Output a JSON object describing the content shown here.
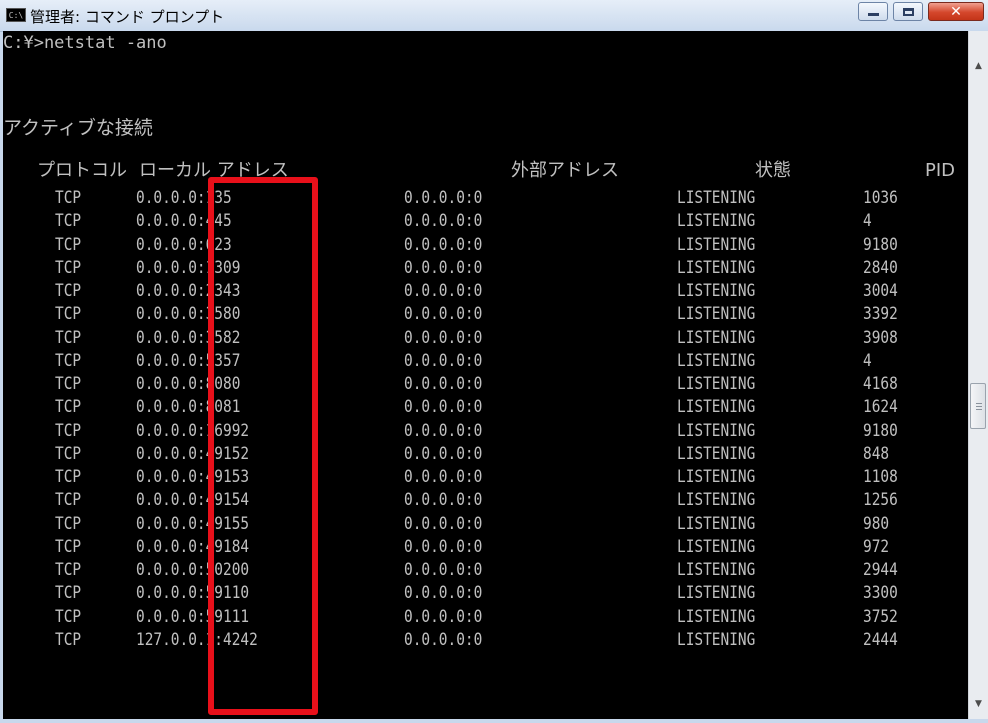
{
  "window": {
    "title": "管理者: コマンド プロンプト",
    "icon_label": "C:\\"
  },
  "console": {
    "command_line": "C:¥>netstat -ano",
    "heading": "アクティブな接続",
    "columns": {
      "proto": "プロトコル",
      "local": "ローカル アドレス",
      "foreign": "外部アドレス",
      "state": "状態",
      "pid": "PID"
    },
    "rows": [
      {
        "proto": "TCP",
        "local": "0.0.0.0:135",
        "foreign": "0.0.0.0:0",
        "state": "LISTENING",
        "pid": "1036"
      },
      {
        "proto": "TCP",
        "local": "0.0.0.0:445",
        "foreign": "0.0.0.0:0",
        "state": "LISTENING",
        "pid": "4"
      },
      {
        "proto": "TCP",
        "local": "0.0.0.0:623",
        "foreign": "0.0.0.0:0",
        "state": "LISTENING",
        "pid": "9180"
      },
      {
        "proto": "TCP",
        "local": "0.0.0.0:1309",
        "foreign": "0.0.0.0:0",
        "state": "LISTENING",
        "pid": "2840"
      },
      {
        "proto": "TCP",
        "local": "0.0.0.0:2343",
        "foreign": "0.0.0.0:0",
        "state": "LISTENING",
        "pid": "3004"
      },
      {
        "proto": "TCP",
        "local": "0.0.0.0:3580",
        "foreign": "0.0.0.0:0",
        "state": "LISTENING",
        "pid": "3392"
      },
      {
        "proto": "TCP",
        "local": "0.0.0.0:3582",
        "foreign": "0.0.0.0:0",
        "state": "LISTENING",
        "pid": "3908"
      },
      {
        "proto": "TCP",
        "local": "0.0.0.0:5357",
        "foreign": "0.0.0.0:0",
        "state": "LISTENING",
        "pid": "4"
      },
      {
        "proto": "TCP",
        "local": "0.0.0.0:8080",
        "foreign": "0.0.0.0:0",
        "state": "LISTENING",
        "pid": "4168"
      },
      {
        "proto": "TCP",
        "local": "0.0.0.0:8081",
        "foreign": "0.0.0.0:0",
        "state": "LISTENING",
        "pid": "1624"
      },
      {
        "proto": "TCP",
        "local": "0.0.0.0:16992",
        "foreign": "0.0.0.0:0",
        "state": "LISTENING",
        "pid": "9180"
      },
      {
        "proto": "TCP",
        "local": "0.0.0.0:49152",
        "foreign": "0.0.0.0:0",
        "state": "LISTENING",
        "pid": "848"
      },
      {
        "proto": "TCP",
        "local": "0.0.0.0:49153",
        "foreign": "0.0.0.0:0",
        "state": "LISTENING",
        "pid": "1108"
      },
      {
        "proto": "TCP",
        "local": "0.0.0.0:49154",
        "foreign": "0.0.0.0:0",
        "state": "LISTENING",
        "pid": "1256"
      },
      {
        "proto": "TCP",
        "local": "0.0.0.0:49155",
        "foreign": "0.0.0.0:0",
        "state": "LISTENING",
        "pid": "980"
      },
      {
        "proto": "TCP",
        "local": "0.0.0.0:49184",
        "foreign": "0.0.0.0:0",
        "state": "LISTENING",
        "pid": "972"
      },
      {
        "proto": "TCP",
        "local": "0.0.0.0:50200",
        "foreign": "0.0.0.0:0",
        "state": "LISTENING",
        "pid": "2944"
      },
      {
        "proto": "TCP",
        "local": "0.0.0.0:59110",
        "foreign": "0.0.0.0:0",
        "state": "LISTENING",
        "pid": "3300"
      },
      {
        "proto": "TCP",
        "local": "0.0.0.0:59111",
        "foreign": "0.0.0.0:0",
        "state": "LISTENING",
        "pid": "3752"
      },
      {
        "proto": "TCP",
        "local": "127.0.0.1:4242",
        "foreign": "0.0.0.0:0",
        "state": "LISTENING",
        "pid": "2444"
      }
    ]
  },
  "annotation": {
    "color": "#e8101a"
  },
  "colors": {
    "console_bg": "#000000",
    "console_text": "#c0c0c0",
    "close_button": "#d4472c"
  }
}
